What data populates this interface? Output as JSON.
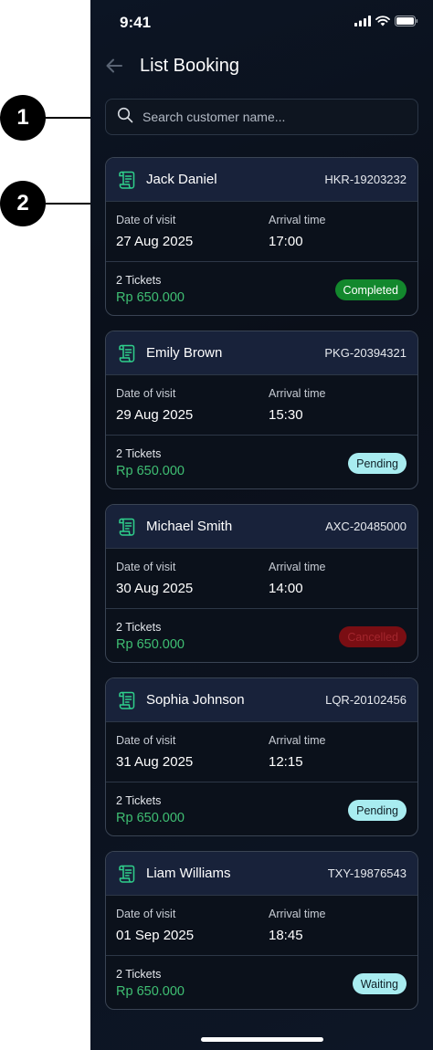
{
  "markers": [
    "1",
    "2"
  ],
  "status_bar": {
    "time": "9:41"
  },
  "header": {
    "title": "List Booking"
  },
  "search": {
    "placeholder": "Search customer name..."
  },
  "bookings": [
    {
      "name": "Jack Daniel",
      "code": "HKR-19203232",
      "date_label": "Date of visit",
      "date": "27 Aug 2025",
      "arrival_label": "Arrival time",
      "arrival": "17:00",
      "tickets": "2 Tickets",
      "price": "Rp 650.000",
      "status": "Completed"
    },
    {
      "name": "Emily Brown",
      "code": "PKG-20394321",
      "date_label": "Date of visit",
      "date": "29 Aug 2025",
      "arrival_label": "Arrival time",
      "arrival": "15:30",
      "tickets": "2 Tickets",
      "price": "Rp 650.000",
      "status": "Pending"
    },
    {
      "name": "Michael Smith",
      "code": "AXC-20485000",
      "date_label": "Date of visit",
      "date": "30 Aug 2025",
      "arrival_label": "Arrival time",
      "arrival": "14:00",
      "tickets": "2 Tickets",
      "price": "Rp 650.000",
      "status": "Cancelled"
    },
    {
      "name": "Sophia Johnson",
      "code": "LQR-20102456",
      "date_label": "Date of visit",
      "date": "31 Aug 2025",
      "arrival_label": "Arrival time",
      "arrival": "12:15",
      "tickets": "2 Tickets",
      "price": "Rp 650.000",
      "status": "Pending"
    },
    {
      "name": "Liam Williams",
      "code": "TXY-19876543",
      "date_label": "Date of visit",
      "date": "01 Sep 2025",
      "arrival_label": "Arrival time",
      "arrival": "18:45",
      "tickets": "2 Tickets",
      "price": "Rp 650.000",
      "status": "Waiting"
    }
  ],
  "colors": {
    "background": "#0a0f19",
    "card_header": "#18223a",
    "price": "#3fbf73",
    "completed": "#13882d",
    "pending": "#a8ecf0",
    "cancelled": "#7a0e13",
    "receipt_icon": "#2fd08c"
  },
  "icons": {
    "back": "arrow-left-icon",
    "search": "search-icon",
    "booking": "receipt-icon",
    "signal": "signal-icon",
    "wifi": "wifi-icon",
    "battery": "battery-icon"
  }
}
